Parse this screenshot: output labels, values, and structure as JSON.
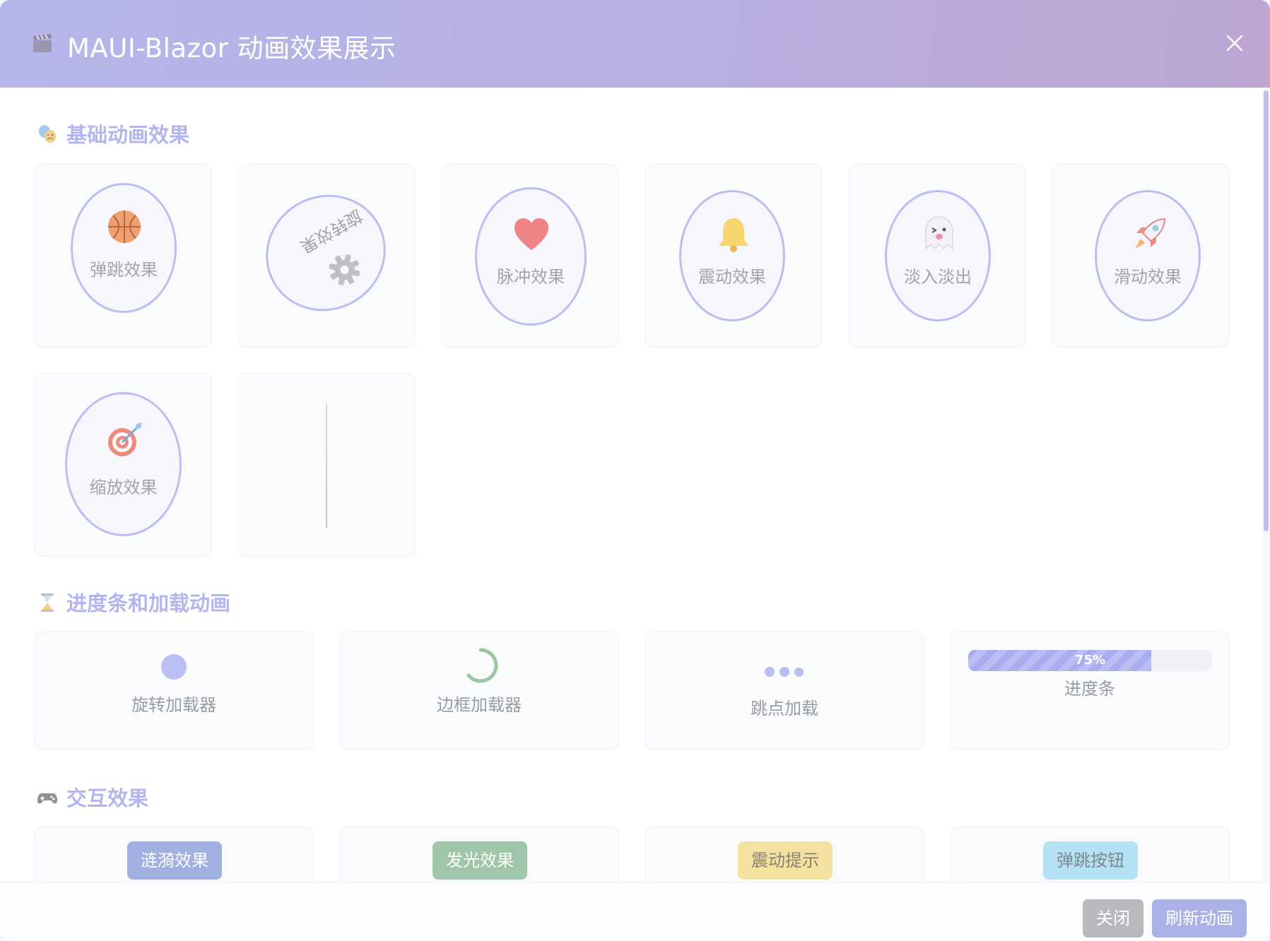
{
  "dialog": {
    "title": "MAUI-Blazor 动画效果展示",
    "title_icon": "clapperboard-icon",
    "close_icon": "close-icon"
  },
  "sections": {
    "basic": {
      "title": "基础动画效果",
      "icon": "theater-masks-icon"
    },
    "progress": {
      "title": "进度条和加载动画",
      "icon": "hourglass-icon"
    },
    "interactive": {
      "title": "交互效果",
      "icon": "game-controller-icon"
    }
  },
  "basic_effects": [
    {
      "label": "弹跳效果",
      "icon": "basketball-icon"
    },
    {
      "label": "旋转效果",
      "icon": "gear-icon"
    },
    {
      "label": "脉冲效果",
      "icon": "heart-icon"
    },
    {
      "label": "震动效果",
      "icon": "bell-icon"
    },
    {
      "label": "淡入淡出",
      "icon": "ghost-icon"
    },
    {
      "label": "滑动效果",
      "icon": "rocket-icon"
    },
    {
      "label": "缩放效果",
      "icon": "target-icon"
    },
    {
      "label": "",
      "icon": ""
    }
  ],
  "loaders": [
    {
      "label": "旋转加载器"
    },
    {
      "label": "边框加载器"
    },
    {
      "label": "跳点加载"
    },
    {
      "label": "进度条",
      "progress_text": "75%",
      "progress": 0.75
    }
  ],
  "interactive_buttons": [
    {
      "label": "涟漪效果",
      "color": "#a0b0e0",
      "text_color": "#ffffff"
    },
    {
      "label": "发光效果",
      "color": "#9fc6a9",
      "text_color": "#ffffff"
    },
    {
      "label": "震动提示",
      "color": "#f6e2a0",
      "text_color": "#8a8070"
    },
    {
      "label": "弹跳按钮",
      "color": "#b4e2f4",
      "text_color": "#7d8890"
    }
  ],
  "footer": {
    "close_label": "关闭",
    "refresh_label": "刷新动画"
  },
  "colors": {
    "accent": "#b3b6ee",
    "header_start": "#b6b6ea",
    "header_end": "#bda6d2",
    "close_button": "#b7b9bd",
    "refresh_button": "#a9b1e6"
  }
}
